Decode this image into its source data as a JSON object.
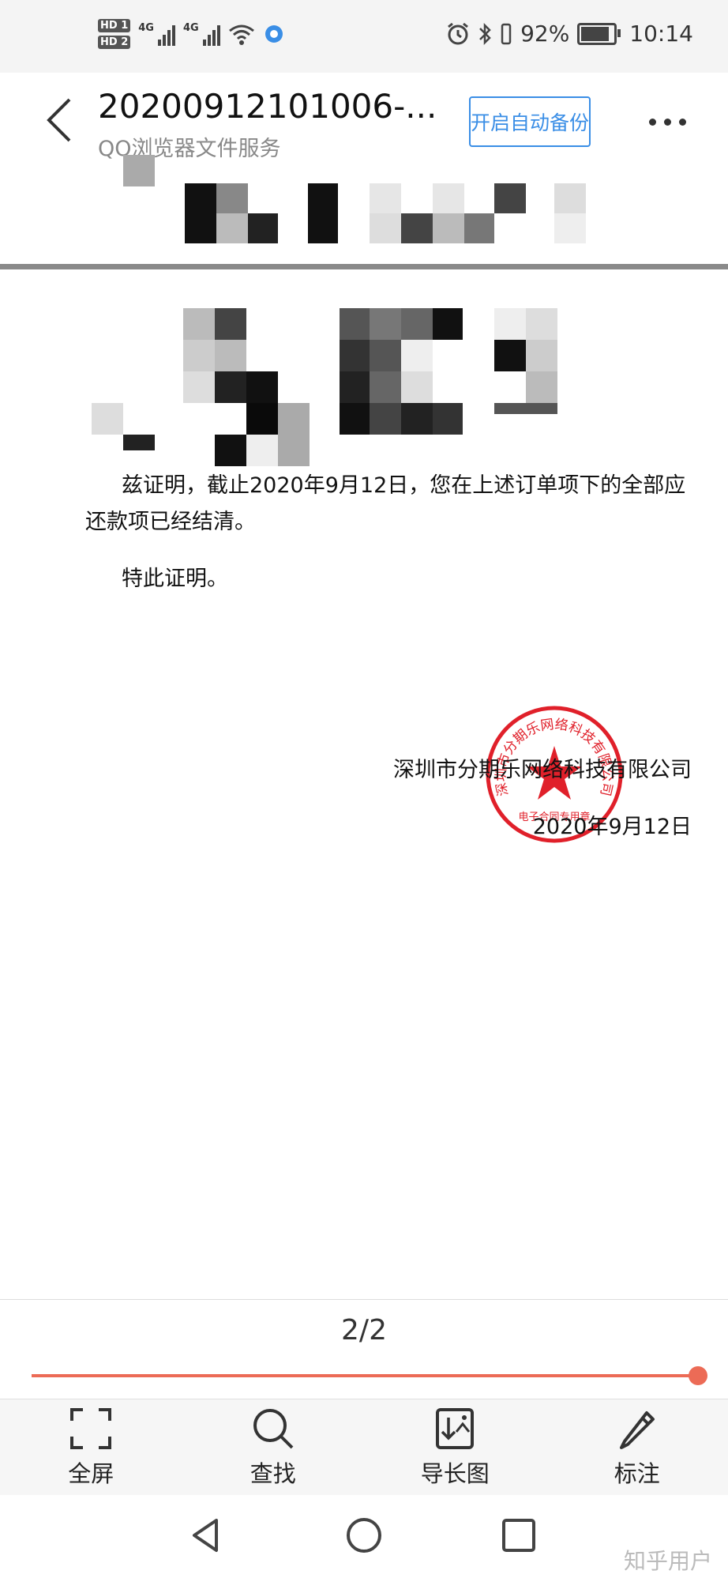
{
  "status_bar": {
    "hd1": "HD 1",
    "hd2": "HD 2",
    "net1": "4G",
    "net2": "4G",
    "battery": "92%",
    "time": "10:14",
    "battery_level": 0.92
  },
  "header": {
    "title": "20200912101006-...",
    "subtitle": "QQ浏览器文件服务",
    "backup_button": "开启自动备份"
  },
  "document": {
    "paragraph1": "兹证明，截止2020年9月12日，您在上述订单项下的全部应还款项已经结清。",
    "paragraph2": "特此证明。",
    "company": "深圳市分期乐网络科技有限公司",
    "date": "2020年9月12日",
    "seal_text": "深圳市分期乐网络科技有限公司",
    "seal_bottom": "电子合同专用章"
  },
  "pager": {
    "label": "2/2",
    "progress": 1.0
  },
  "toolbar": {
    "fullscreen": "全屏",
    "find": "查找",
    "export_long": "导长图",
    "annotate": "标注"
  },
  "watermark": "知乎用户",
  "colors": {
    "accent_blue": "#3a8ee6",
    "progress_red": "#ec6b56",
    "seal_red": "#e0202a"
  }
}
